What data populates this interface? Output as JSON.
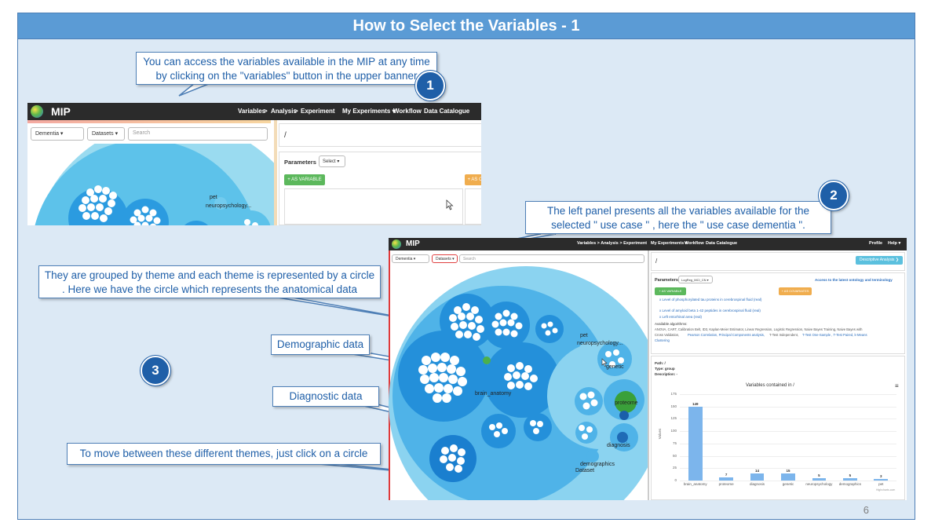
{
  "slide": {
    "title": "How to Select the Variables - 1",
    "page_number": "6"
  },
  "callouts": {
    "c1": "You can access the variables available in the MIP at any time by clicking on the \"variables\" button in the upper banner",
    "c2": "The left panel presents all the variables available for the selected \" use case \" , here the \" use case dementia \".",
    "c3": "They are grouped by theme and each theme is represented by a circle . Here we have the circle which represents the anatomical data",
    "demographic": "Demographic data",
    "diagnostic": "Diagnostic data",
    "move": "To move between these different themes, just click on a circle"
  },
  "badges": {
    "b1": "1",
    "b2": "2",
    "b3": "3"
  },
  "shot1": {
    "brand": "MIP",
    "nav": {
      "variables": "Variables",
      "sep1": ">",
      "analysis": "Analysis",
      "sep2": ">",
      "experiment": "Experiment",
      "my_experiments": "My Experiments ▾",
      "workflow": "Workflow",
      "catalogue": "Data Catalogue"
    },
    "pathology": "Dementia ▾",
    "datasets": "Datasets ▾",
    "search_placeholder": "Search",
    "path": "/",
    "parameters": "Parameters",
    "select": "Select ▾",
    "as_variable": "+ AS VARIABLE",
    "as_covariate": "+ AS C",
    "labels": {
      "pet": "pet",
      "neuro": "neuropsychology..."
    }
  },
  "shot2": {
    "brand": "MIP",
    "nav": {
      "variables": "Variables > Analysis > Experiment",
      "my_experiments": "My Experiments ▾",
      "workflow": "Workflow",
      "catalogue": "Data Catalogue",
      "profile": "Profile",
      "help": "Help ▾"
    },
    "pathology": "Dementia ▾",
    "datasets": "Datasets ▾",
    "search_placeholder": "Search",
    "path": "/",
    "descriptive": "Descriptive Analysis ❯",
    "parameters": "Parameters",
    "select": "LogReg_MCI_CN ▾",
    "ontology_link": "Access to the latest ontology and terminology",
    "as_variable": "+ AS VARIABLE",
    "as_covariates": "+ AS COVARIATES",
    "vars": [
      "x Level of phosphorylated tau proteins in cerebrospinal fluid (real)",
      "x Level of amyloid beta 1-42 peptides in cerebrospinal fluid (real)",
      "x Left entorhinal area (real)"
    ],
    "algorithms_label": "Available algorithms:",
    "algorithms_1": "ANOVA, CART, Calibration Belt, ID3, Kaplan-Meier Estimator, Linear Regression, Logistic Regression, Naive Bayes Training, Naive Bayes with",
    "algorithms_2": "Cross Validation,",
    "algorithms_2b": "Pearson Correlation, Principal Components analysis,",
    "algorithms_2c": "T-Test Independent,",
    "algorithms_2d": "T-Test One-Sample , T-Test Paired, k-Means",
    "algorithms_3": "Clustering",
    "info": {
      "path": "Path: /",
      "type": "Type: group",
      "description": "Description: -"
    },
    "labels": {
      "pet": "pet",
      "neuro": "neuropsychology...",
      "genetic": "genetic",
      "brain": "brain_anatomy",
      "proteome": "proteome",
      "diagnosis": "diagnosis",
      "demographics": "demographics",
      "dataset": "Dataset"
    },
    "menu_icon": "≡"
  },
  "chart_data": {
    "type": "bar",
    "title": "Variables contained in /",
    "ylabel": "Values",
    "categories": [
      "brain_anatomy",
      "proteome",
      "diagnosis",
      "genetic",
      "neuropsychology",
      "demographics",
      "pet"
    ],
    "values": [
      149,
      7,
      14,
      15,
      5,
      5,
      3
    ],
    "ylim": [
      0,
      175
    ],
    "yticks": [
      0,
      25,
      50,
      75,
      100,
      125,
      150,
      175
    ],
    "credit": "Highcharts.com",
    "grid": true,
    "legend": "none",
    "bar_color": "#7cb5ec"
  }
}
